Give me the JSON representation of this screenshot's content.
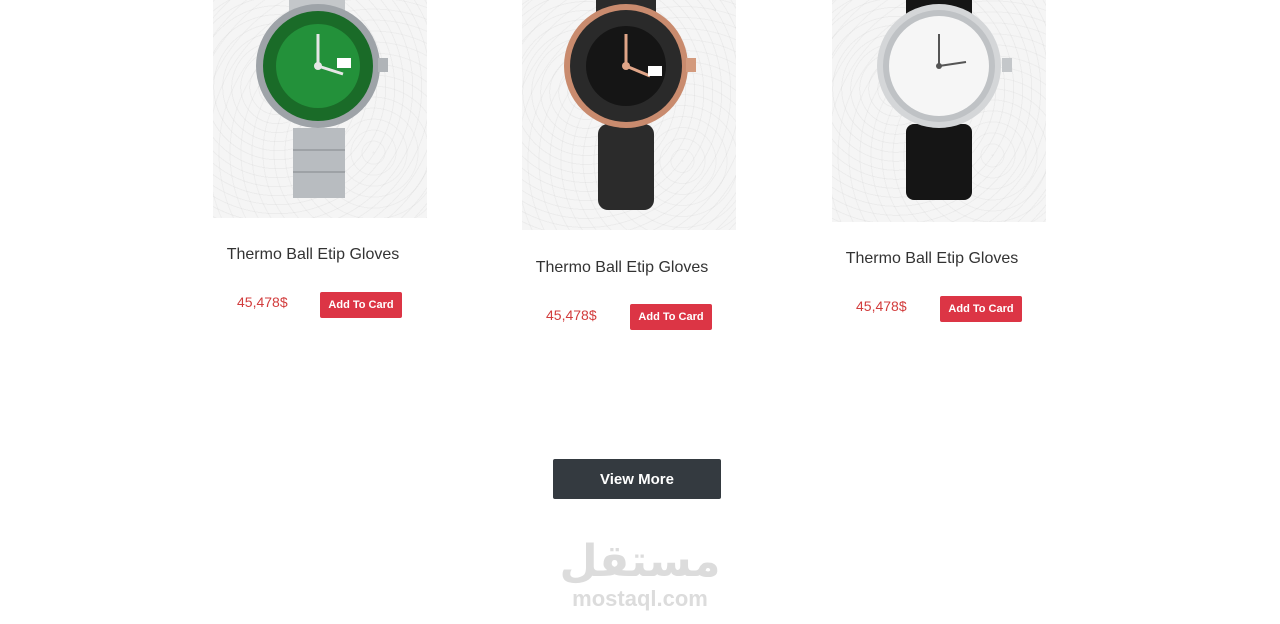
{
  "products": [
    {
      "name": "Thermo Ball Etip Gloves",
      "price": "45,478$",
      "button_label": "Add To Card",
      "image_icon": "green-submariner-watch-image",
      "dial_color": "#1f7a2e",
      "strap_color": "#b8bcc0"
    },
    {
      "name": "Thermo Ball Etip Gloves",
      "price": "45,478$",
      "button_label": "Add To Card",
      "image_icon": "black-rose-gold-watch-image",
      "dial_color": "#1c1c1c",
      "strap_color": "#2b2b2b"
    },
    {
      "name": "Thermo Ball Etip Gloves",
      "price": "45,478$",
      "button_label": "Add To Card",
      "image_icon": "white-dress-watch-image",
      "dial_color": "#f4f4f4",
      "strap_color": "#151515"
    }
  ],
  "view_more_label": "View More",
  "watermark": {
    "arabic": "مستقل",
    "latin": "mostaql.com"
  },
  "colors": {
    "price": "#d23c3c",
    "add_button": "#dc3545",
    "view_more_button": "#343a40"
  }
}
